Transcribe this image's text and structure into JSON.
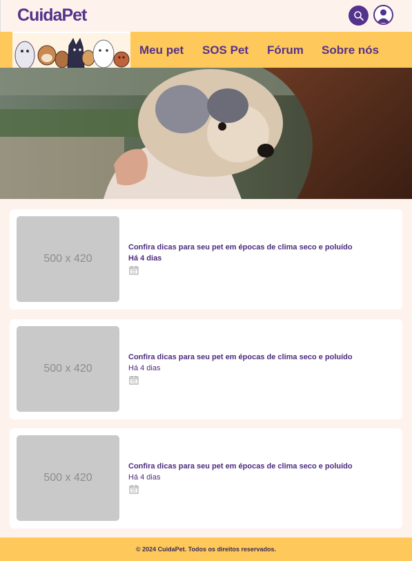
{
  "header": {
    "logo": "CuidaPet",
    "search_icon": "search-icon",
    "user_icon": "user-icon"
  },
  "nav": {
    "items": [
      {
        "label": "Meu pet"
      },
      {
        "label": "SOS Pet"
      },
      {
        "label": "Fórum"
      },
      {
        "label": "Sobre nós"
      }
    ]
  },
  "posts": [
    {
      "placeholder": "500 x 420",
      "title": "Confira dicas para seu pet em épocas de clima seco e poluído",
      "date": "Há 4 dias"
    },
    {
      "placeholder": "500 x 420",
      "title": "Confira dicas para seu pet em épocas de clima seco e poluído",
      "date": "Há 4 dias"
    },
    {
      "placeholder": "500 x 420",
      "title": "Confira dicas para seu pet em épocas de clima seco e poluído",
      "date": "Há 4 dias"
    }
  ],
  "footer": {
    "text": "© 2024 CuidaPet. Todos os direitos reservados."
  },
  "colors": {
    "brand": "#55328b",
    "nav_bg": "#fec95a",
    "page_bg": "#fdf3ec"
  }
}
